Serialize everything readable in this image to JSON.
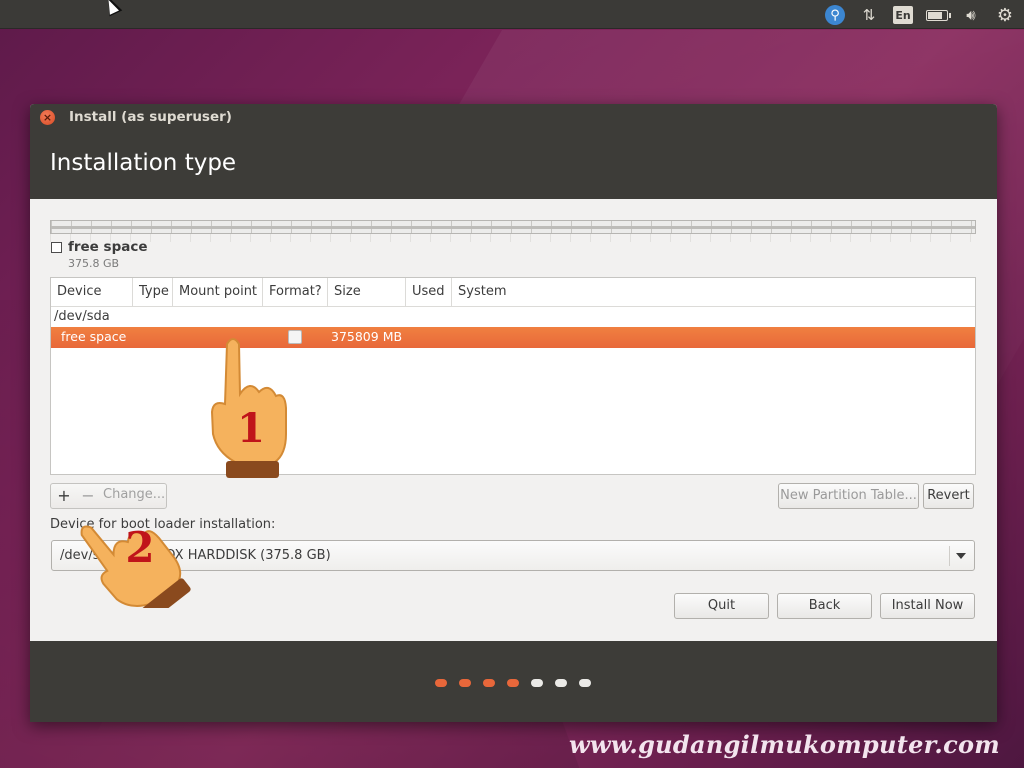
{
  "top_panel": {
    "tray_icons": [
      "accessibility-icon",
      "network-icon",
      "keyboard-language-icon",
      "battery-icon",
      "volume-icon",
      "settings-gear-icon"
    ],
    "language": "En"
  },
  "window": {
    "title": "Install (as superuser)",
    "page_title": "Installation type",
    "legend": {
      "label": "free space",
      "size": "375.8 GB"
    },
    "table": {
      "columns": [
        "Device",
        "Type",
        "Mount point",
        "Format?",
        "Size",
        "Used",
        "System"
      ],
      "device": "/dev/sda",
      "rows": [
        {
          "device": "free space",
          "type": "",
          "mount": "",
          "format": false,
          "size": "375809 MB",
          "used": "",
          "system": ""
        }
      ]
    },
    "toolbar": {
      "add": "+",
      "remove": "−",
      "change": "Change..."
    },
    "new_partition_table": "New Partition Table...",
    "revert": "Revert",
    "boot_label": "Device for boot loader installation:",
    "boot_value": "/dev/sda   ATA VBOX HARDDISK (375.8 GB)",
    "buttons": {
      "quit": "Quit",
      "back": "Back",
      "install": "Install Now"
    },
    "progress": {
      "total": 7,
      "done": 4,
      "done_color": "#e8673a",
      "todo_color": "#ebeae7"
    }
  },
  "annotations": {
    "step1": "1",
    "step2": "2",
    "accent": "#c0141a"
  },
  "watermark": "www.gudangilmukomputer.com"
}
